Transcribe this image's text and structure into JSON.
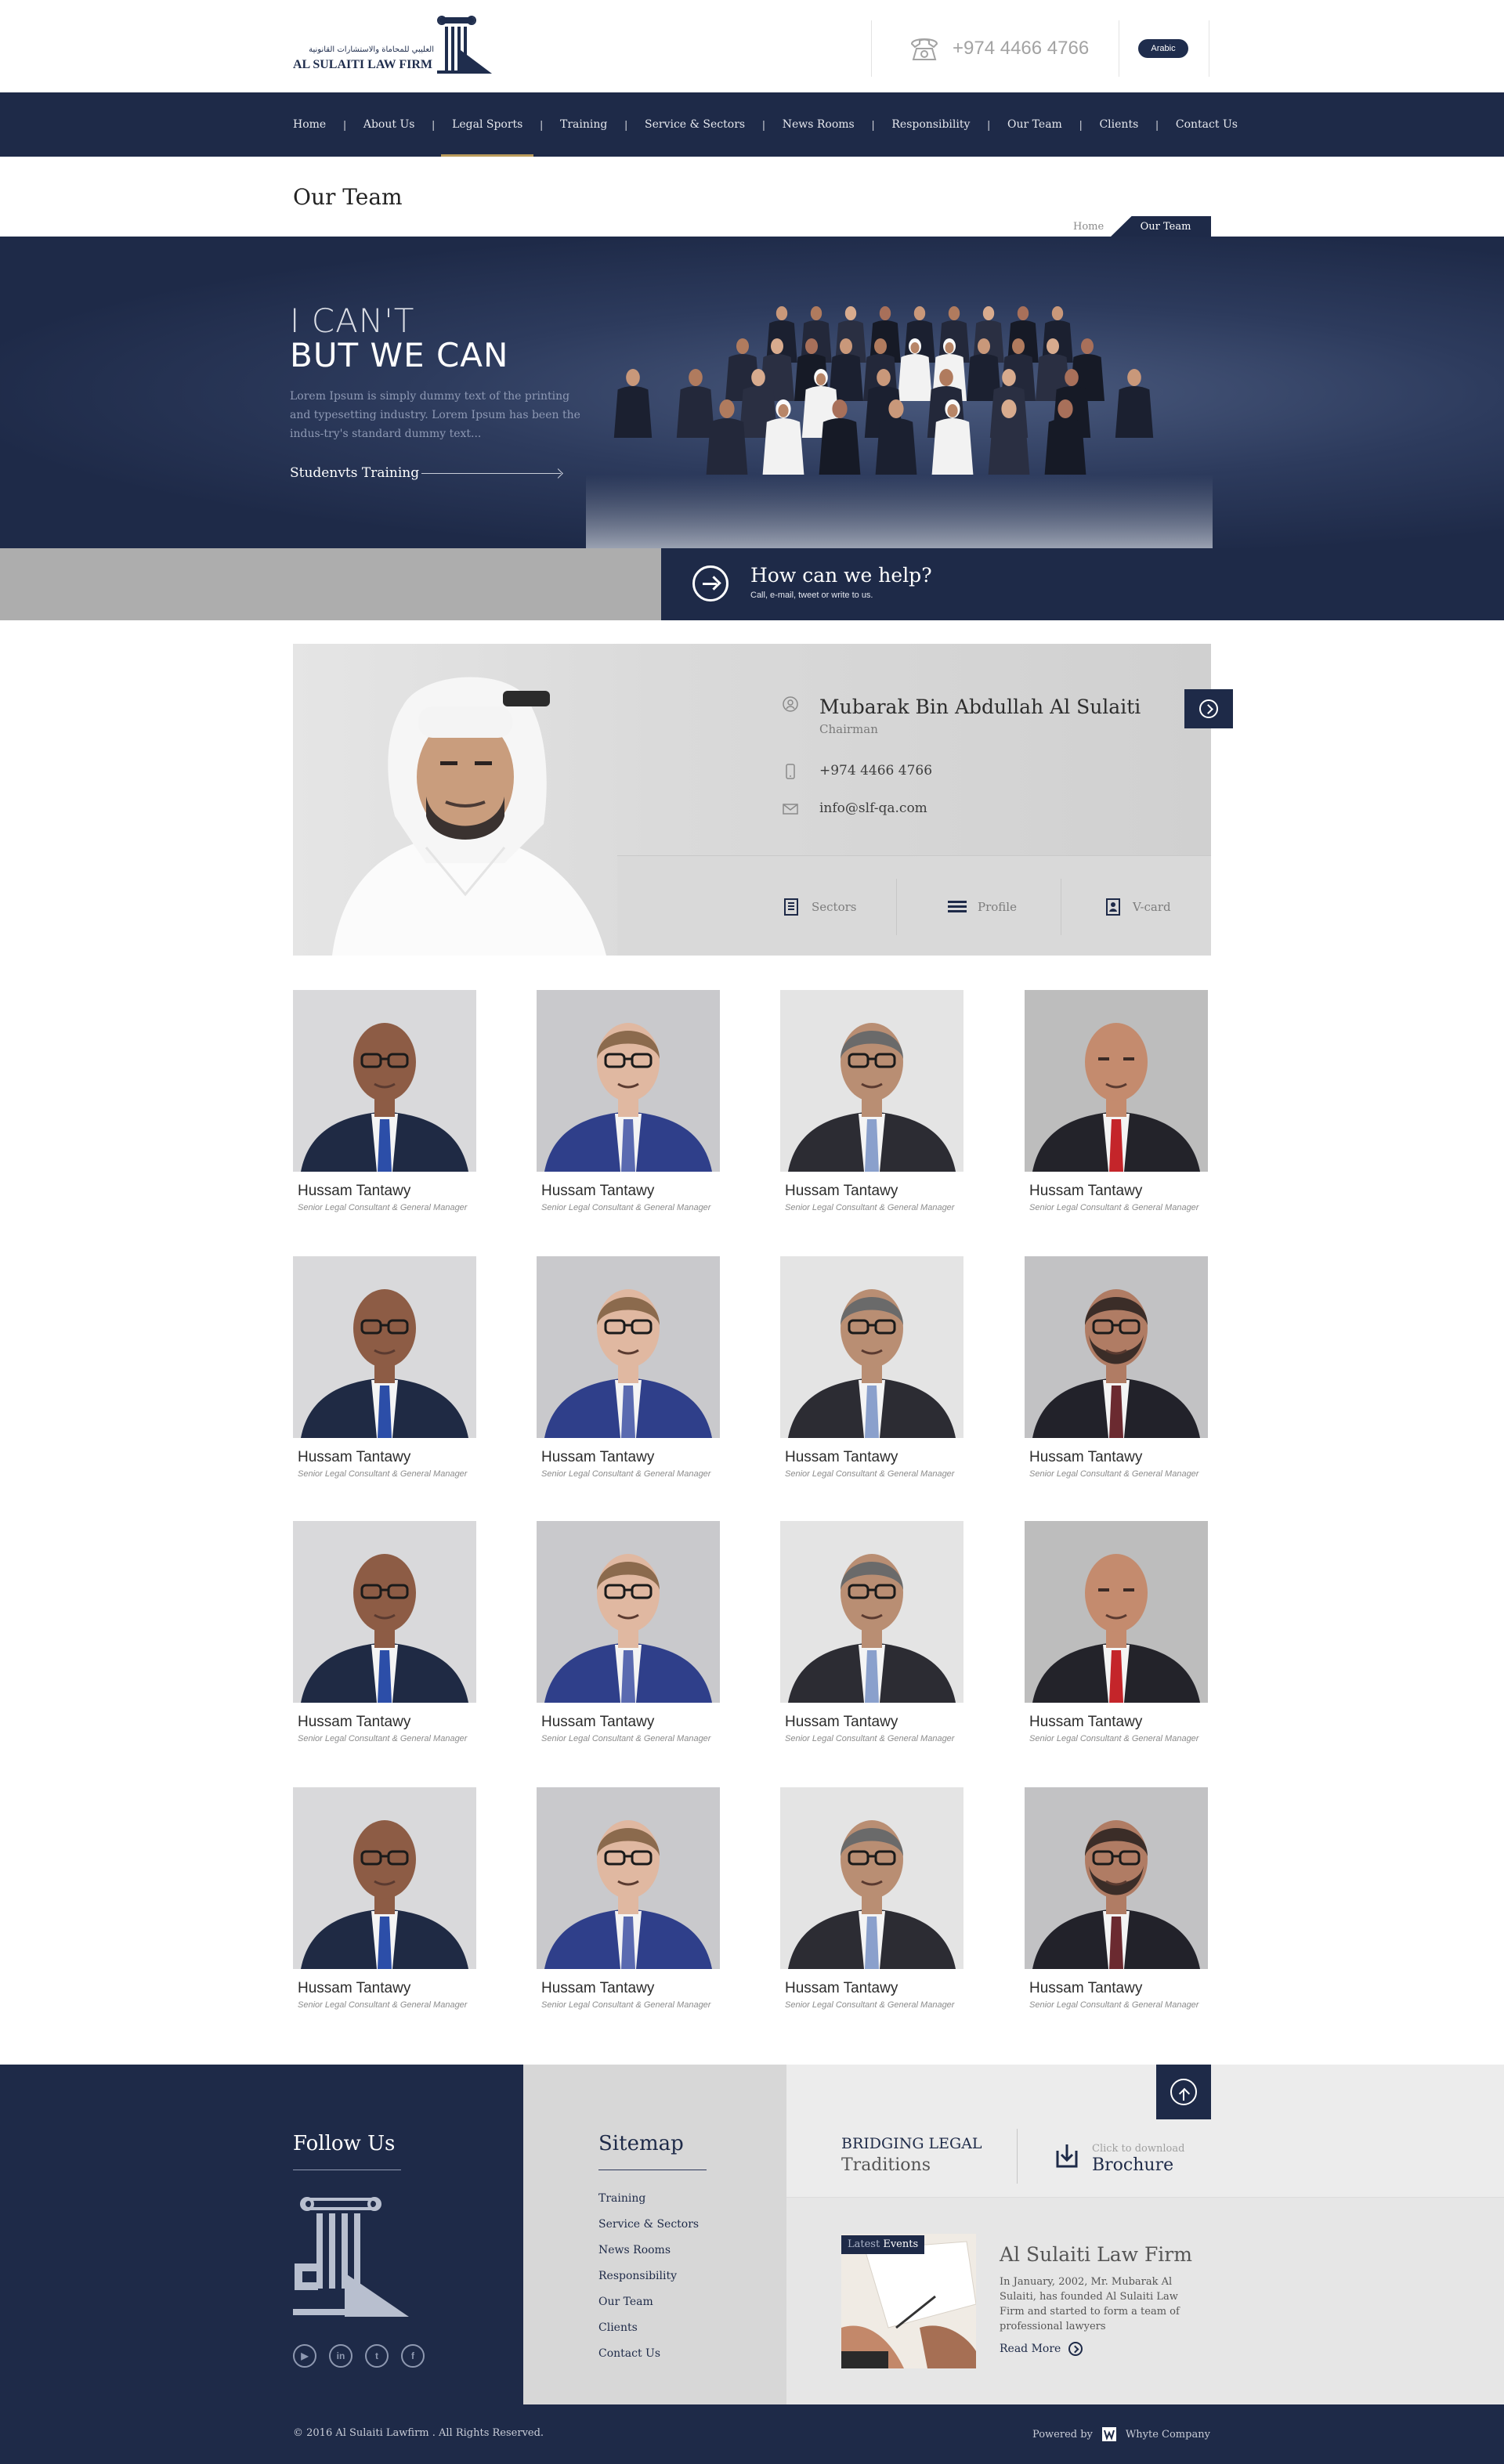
{
  "header": {
    "logo_arabic": "العليبي للمحاماة والاستشارات القانونية",
    "logo_text": "AL SULAITI LAW FIRM",
    "phone": "+974 4466 4766",
    "language_button": "Arabic"
  },
  "nav": {
    "items": [
      {
        "label": "Home"
      },
      {
        "label": "About Us"
      },
      {
        "label": "Legal Sports"
      },
      {
        "label": "Training"
      },
      {
        "label": "Service & Sectors"
      },
      {
        "label": "News Rooms"
      },
      {
        "label": "Responsibility"
      },
      {
        "label": "Our Team"
      },
      {
        "label": "Clients"
      },
      {
        "label": "Contact Us"
      }
    ],
    "active": "Legal Sports"
  },
  "page": {
    "title": "Our Team",
    "breadcrumb": {
      "home": "Home",
      "current": "Our Team"
    }
  },
  "hero": {
    "line1": "I CAN'T",
    "line2": "BUT WE CAN",
    "text": "Lorem Ipsum is simply dummy text of the printing and typesetting industry. Lorem Ipsum has been the indus-try's standard dummy text...",
    "link": "Studenvts Training"
  },
  "help": {
    "title": "How can we help?",
    "subtitle": "Call, e-mail, tweet or write to us."
  },
  "chairman": {
    "name": "Mubarak Bin Abdullah Al Sulaiti",
    "role": "Chairman",
    "phone": "+974 4466 4766",
    "email": "info@slf-qa.com",
    "actions": {
      "sectors": "Sectors",
      "profile": "Profile",
      "vcard": "V-card"
    }
  },
  "team": [
    {
      "name": "Hussam Tantawy",
      "role": "Senior Legal Consultant & General Manager",
      "portrait": "bald-blue-tie"
    },
    {
      "name": "Hussam Tantawy",
      "role": "Senior Legal Consultant & General Manager",
      "portrait": "glasses-blue-suit"
    },
    {
      "name": "Hussam Tantawy",
      "role": "Senior Legal Consultant & General Manager",
      "portrait": "grey-hair-glasses"
    },
    {
      "name": "Hussam Tantawy",
      "role": "Senior Legal Consultant & General Manager",
      "portrait": "red-tie"
    },
    {
      "name": "Hussam Tantawy",
      "role": "Senior Legal Consultant & General Manager",
      "portrait": "bald-blue-tie"
    },
    {
      "name": "Hussam Tantawy",
      "role": "Senior Legal Consultant & General Manager",
      "portrait": "glasses-blue-suit"
    },
    {
      "name": "Hussam Tantawy",
      "role": "Senior Legal Consultant & General Manager",
      "portrait": "grey-hair-glasses"
    },
    {
      "name": "Hussam Tantawy",
      "role": "Senior Legal Consultant & General Manager",
      "portrait": "beard-glasses"
    },
    {
      "name": "Hussam Tantawy",
      "role": "Senior Legal Consultant & General Manager",
      "portrait": "bald-blue-tie"
    },
    {
      "name": "Hussam Tantawy",
      "role": "Senior Legal Consultant & General Manager",
      "portrait": "glasses-blue-suit"
    },
    {
      "name": "Hussam Tantawy",
      "role": "Senior Legal Consultant & General Manager",
      "portrait": "grey-hair-glasses"
    },
    {
      "name": "Hussam Tantawy",
      "role": "Senior Legal Consultant & General Manager",
      "portrait": "red-tie"
    },
    {
      "name": "Hussam Tantawy",
      "role": "Senior Legal Consultant & General Manager",
      "portrait": "bald-blue-tie"
    },
    {
      "name": "Hussam Tantawy",
      "role": "Senior Legal Consultant & General Manager",
      "portrait": "glasses-blue-suit"
    },
    {
      "name": "Hussam Tantawy",
      "role": "Senior Legal Consultant & General Manager",
      "portrait": "grey-hair-glasses"
    },
    {
      "name": "Hussam Tantawy",
      "role": "Senior Legal Consultant & General Manager",
      "portrait": "beard-glasses"
    }
  ],
  "footer": {
    "follow_title": "Follow Us",
    "social": [
      {
        "icon": "youtube-icon",
        "glyph": "▶"
      },
      {
        "icon": "linkedin-icon",
        "glyph": "in"
      },
      {
        "icon": "twitter-icon",
        "glyph": "t"
      },
      {
        "icon": "facebook-icon",
        "glyph": "f"
      }
    ],
    "sitemap_title": "Sitemap",
    "sitemap": [
      "Training",
      "Service & Sectors",
      "News Rooms",
      "Responsibility",
      "Our Team",
      "Clients",
      "Contact Us"
    ],
    "bridging_1": "BRIDGING LEGAL",
    "bridging_2": "Traditions",
    "download_hint": "Click to download",
    "download_label": "Brochure",
    "events_badge_1": "Latest",
    "events_badge_2": "Events",
    "firm_title": "Al Sulaiti Law Firm",
    "firm_text": "In January, 2002, Mr. Mubarak Al Sulaiti, has founded Al Sulaiti Law Firm and started to form a team of professional lawyers",
    "read_more": "Read More",
    "copyright": "© 2016 Al Sulaiti Lawfirm . All Rights Reserved.",
    "powered_by": "Powered by",
    "company": "Whyte Company"
  },
  "colors": {
    "navy": "#1e2a48",
    "gold_accent": "#b99a5b",
    "grey": "#adadad"
  }
}
